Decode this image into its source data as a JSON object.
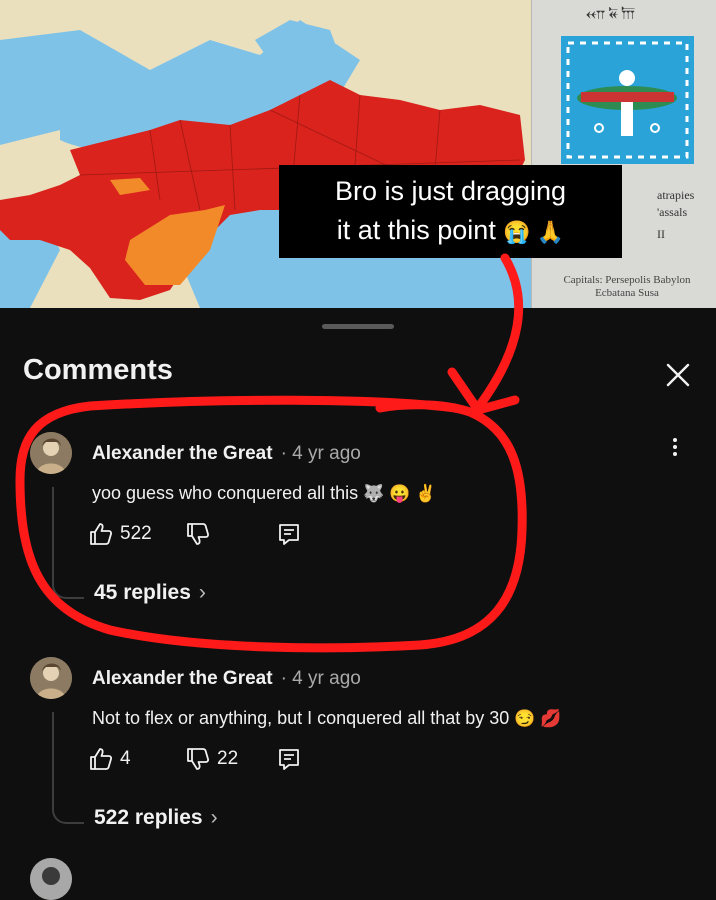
{
  "video": {
    "caption_line1": "Bro is just dragging",
    "caption_line2": "it at this point",
    "caption_emojis": "😭 🙏",
    "cuneiform_header": "𐎧𐏁𐎠",
    "legend_line1": "atrapies",
    "legend_line2": "'assals",
    "legend_line3": "II",
    "capitals_line1": "Capitals: Persepolis  Babylon",
    "capitals_line2": "Ecbatana    Susa"
  },
  "comments_panel": {
    "title": "Comments",
    "comments": [
      {
        "author": "Alexander the Great",
        "time": "· 4 yr ago",
        "text": "yoo guess who conquered all this",
        "text_emojis": "🐺 😛 ✌",
        "likes": "522",
        "dislikes": "",
        "replies": "45 replies"
      },
      {
        "author": "Alexander the Great",
        "time": "· 4 yr ago",
        "text": "Not to flex or anything, but I conquered all that by 30",
        "text_emojis": "😏 💋",
        "likes": "4",
        "dislikes": "22",
        "replies": "522 replies"
      }
    ]
  },
  "colors": {
    "background": "#0f0f0f",
    "empire_red": "#d9231c",
    "annotation_red": "#ff1a1a",
    "sea_blue": "#7fc2e8"
  },
  "icons": [
    "like-icon",
    "dislike-icon",
    "reply-icon",
    "close-icon",
    "more-vert-icon",
    "chevron-right-icon"
  ]
}
